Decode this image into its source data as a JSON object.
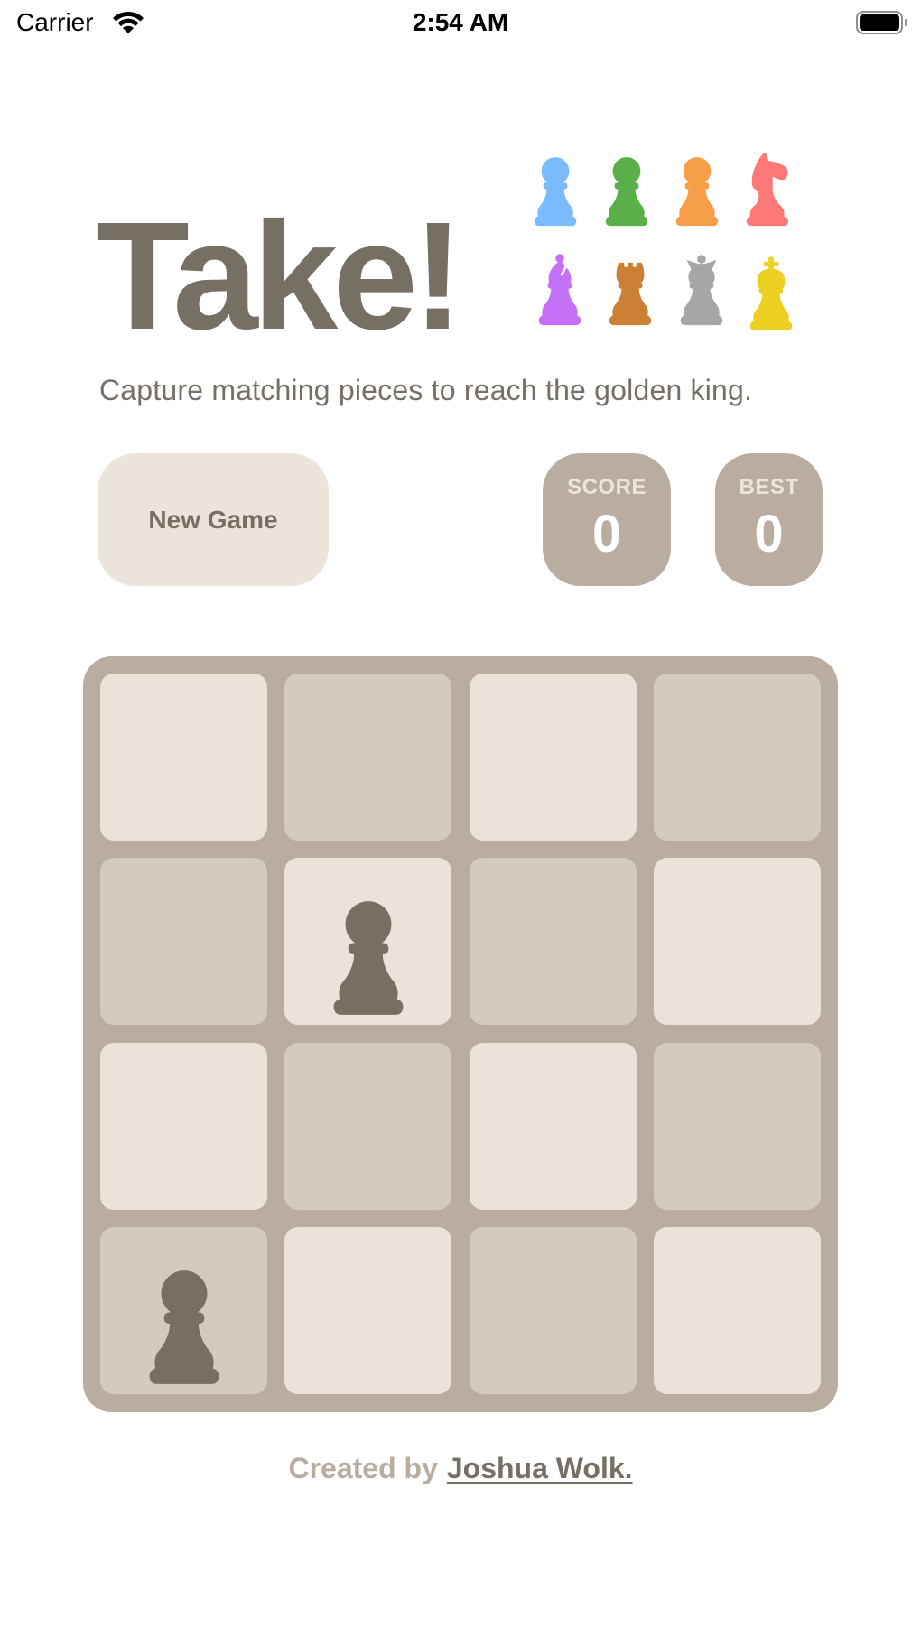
{
  "status_bar": {
    "carrier": "Carrier",
    "time": "2:54 AM",
    "wifi_icon": "wifi-icon",
    "battery_icon": "battery-full-icon"
  },
  "header": {
    "title": "Take!",
    "subtitle": "Capture matching pieces to reach the golden king.",
    "piece_legend": [
      {
        "piece": "pawn",
        "color": "#78bcff",
        "icon": "pawn-icon"
      },
      {
        "piece": "pawn",
        "color": "#5ab048",
        "icon": "pawn-icon"
      },
      {
        "piece": "pawn",
        "color": "#f79e4a",
        "icon": "pawn-icon"
      },
      {
        "piece": "knight",
        "color": "#ff7878",
        "icon": "knight-icon"
      },
      {
        "piece": "bishop",
        "color": "#c471f7",
        "icon": "bishop-icon"
      },
      {
        "piece": "rook",
        "color": "#cc8033",
        "icon": "rook-icon"
      },
      {
        "piece": "queen",
        "color": "#a6a6a6",
        "icon": "queen-icon"
      },
      {
        "piece": "king",
        "color": "#edcf22",
        "icon": "king-icon"
      }
    ]
  },
  "controls": {
    "new_game_label": "New Game",
    "score_label": "SCORE",
    "score_value": "0",
    "best_label": "BEST",
    "best_value": "0"
  },
  "board": {
    "size": 4,
    "piece_color": "#766f64",
    "light_color": "#ebe3da",
    "dark_color": "#d3cac0",
    "pieces": [
      {
        "row": 1,
        "col": 1,
        "piece": "pawn"
      },
      {
        "row": 3,
        "col": 0,
        "piece": "pawn"
      }
    ]
  },
  "footer": {
    "created_by": "Created by",
    "author": "Joshua Wolk."
  }
}
